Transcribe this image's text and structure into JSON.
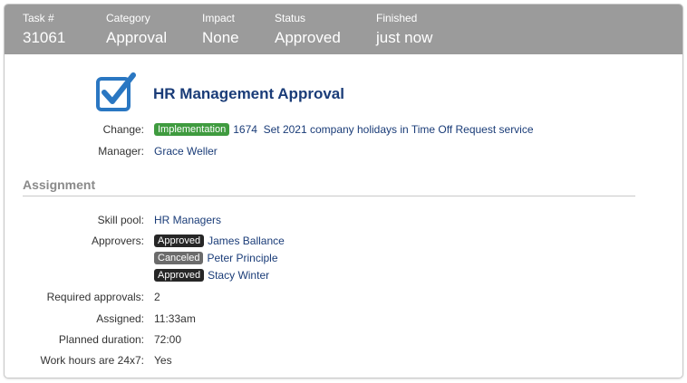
{
  "header": {
    "task": {
      "label": "Task #",
      "value": "31061"
    },
    "category": {
      "label": "Category",
      "value": "Approval"
    },
    "impact": {
      "label": "Impact",
      "value": "None"
    },
    "status": {
      "label": "Status",
      "value": "Approved"
    },
    "finished": {
      "label": "Finished",
      "value": "just now"
    }
  },
  "icons": {
    "task_type": "checkbox-checked-icon"
  },
  "colors": {
    "header_bg": "#9b9b9b",
    "title": "#1a3c78",
    "icon": "#2a77c2",
    "implementation_badge": "#3f9b3f"
  },
  "title": "HR Management Approval",
  "change": {
    "label": "Change:",
    "badge": "Implementation",
    "number": "1674",
    "description": "Set 2021 company holidays in Time Off Request service"
  },
  "manager": {
    "label": "Manager:",
    "value": "Grace Weller"
  },
  "assignment": {
    "section_title": "Assignment",
    "skill_pool": {
      "label": "Skill pool:",
      "value": "HR Managers"
    },
    "approvers_label": "Approvers:",
    "approvers": [
      {
        "status": "Approved",
        "name": "James Ballance"
      },
      {
        "status": "Canceled",
        "name": "Peter Principle"
      },
      {
        "status": "Approved",
        "name": "Stacy Winter"
      }
    ],
    "required_approvals": {
      "label": "Required approvals:",
      "value": "2"
    },
    "assigned": {
      "label": "Assigned:",
      "value": "11:33am"
    },
    "planned_duration": {
      "label": "Planned duration:",
      "value": "72:00"
    },
    "work_hours": {
      "label": "Work hours are 24x7:",
      "value": "Yes"
    }
  }
}
